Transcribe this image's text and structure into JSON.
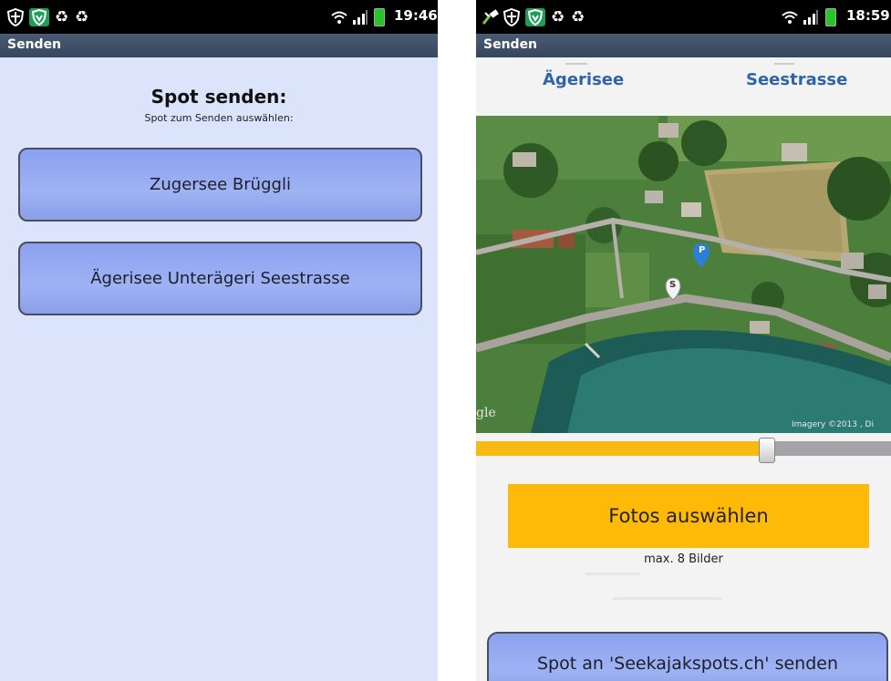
{
  "left_screen": {
    "status": {
      "time": "19:46"
    },
    "titlebar": {
      "title": "Senden"
    },
    "heading": "Spot senden:",
    "subheading": "Spot zum Senden auswählen:",
    "spots": [
      {
        "label": "Zugersee  Brüggli"
      },
      {
        "label": "Ägerisee  Unterägeri Seestrasse"
      }
    ]
  },
  "right_screen": {
    "status": {
      "time": "18:59"
    },
    "titlebar": {
      "title": "Senden"
    },
    "tabs": [
      {
        "label": "Ägerisee"
      },
      {
        "label": "Seestrasse"
      }
    ],
    "map": {
      "attribution_left": "gle",
      "attribution_right": "Imagery ©2013 , Di",
      "marker_parking": "P",
      "marker_spot": "S"
    },
    "slider": {
      "value": 0.7
    },
    "fotos_button": {
      "label": "Fotos auswählen"
    },
    "fotos_hint": "max. 8 Bilder",
    "send_button": {
      "label": "Spot an 'Seekajakspots.ch' senden"
    }
  },
  "colors": {
    "accent_orange": "#ffb907",
    "button_blue": "#9fb2f4",
    "tab_blue": "#2f64aa",
    "titlebar": "#3f5069"
  }
}
